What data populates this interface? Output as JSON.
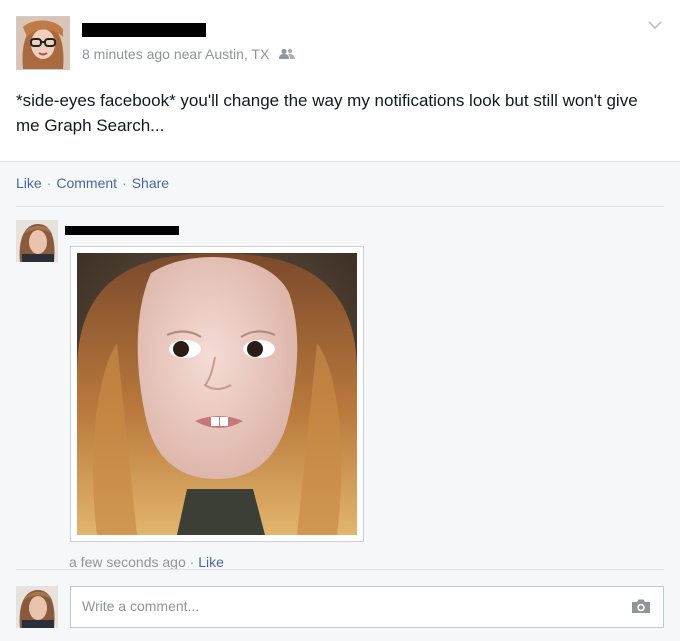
{
  "post": {
    "timestamp": "8 minutes ago",
    "location": "near Austin, TX",
    "text": "*side-eyes facebook* you'll change the way my notifications look but still won't give me Graph Search..."
  },
  "actions": {
    "like": "Like",
    "comment": "Comment",
    "share": "Share",
    "separator": "·"
  },
  "comment": {
    "time": "a few seconds ago",
    "separator": "·",
    "like": "Like"
  },
  "composer": {
    "placeholder": "Write a comment..."
  },
  "icons": {
    "audience": "friends-icon",
    "menu": "chevron-down-icon",
    "photo": "camera-icon"
  },
  "colors": {
    "link": "#4b67a1",
    "meta": "#90949c",
    "footer_bg": "#f6f7f9"
  }
}
